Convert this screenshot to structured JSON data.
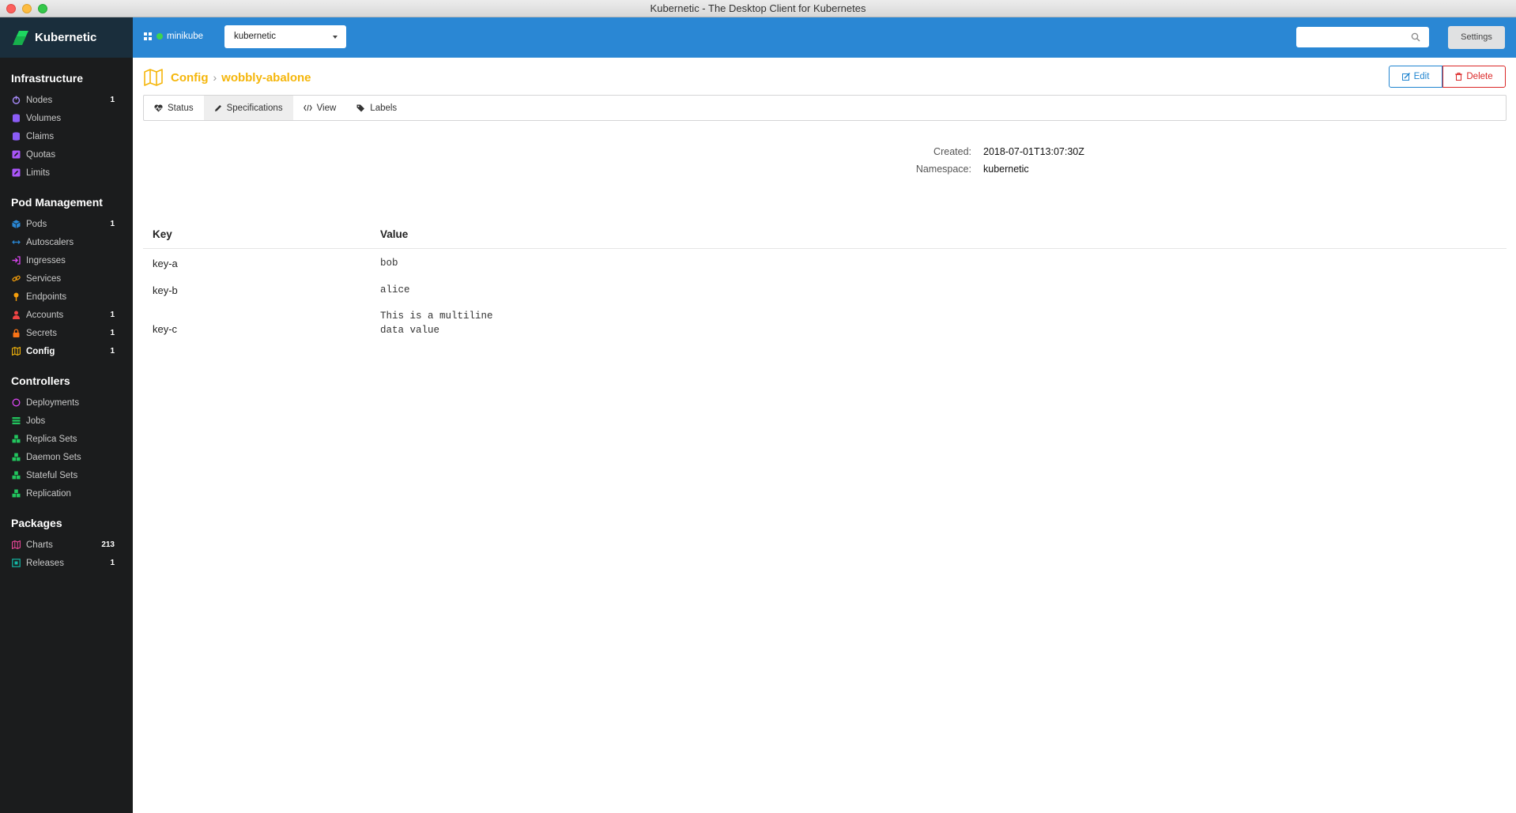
{
  "window": {
    "title": "Kubernetic - The Desktop Client for Kubernetes"
  },
  "brand": {
    "name": "Kubernetic"
  },
  "sidebar": {
    "sections": [
      {
        "title": "Infrastructure",
        "items": [
          {
            "label": "Nodes",
            "count": "1",
            "icon": "power-icon",
            "color": "#a78bfa"
          },
          {
            "label": "Volumes",
            "count": "",
            "icon": "database-icon",
            "color": "#8b5cf6"
          },
          {
            "label": "Claims",
            "count": "",
            "icon": "database-icon",
            "color": "#8b5cf6"
          },
          {
            "label": "Quotas",
            "count": "",
            "icon": "edit-square-icon",
            "color": "#a855f7"
          },
          {
            "label": "Limits",
            "count": "",
            "icon": "edit-square-icon",
            "color": "#a855f7"
          }
        ]
      },
      {
        "title": "Pod Management",
        "items": [
          {
            "label": "Pods",
            "count": "1",
            "icon": "cube-icon",
            "color": "#2a87d4"
          },
          {
            "label": "Autoscalers",
            "count": "",
            "icon": "arrows-h-icon",
            "color": "#2a87d4"
          },
          {
            "label": "Ingresses",
            "count": "",
            "icon": "sign-in-icon",
            "color": "#d946ef"
          },
          {
            "label": "Services",
            "count": "",
            "icon": "link-icon",
            "color": "#f59e0b"
          },
          {
            "label": "Endpoints",
            "count": "",
            "icon": "pin-icon",
            "color": "#f59e0b"
          },
          {
            "label": "Accounts",
            "count": "1",
            "icon": "user-icon",
            "color": "#ef4444"
          },
          {
            "label": "Secrets",
            "count": "1",
            "icon": "lock-icon",
            "color": "#f97316"
          },
          {
            "label": "Config",
            "count": "1",
            "icon": "map-icon",
            "color": "#f5b60b",
            "active": true
          }
        ]
      },
      {
        "title": "Controllers",
        "items": [
          {
            "label": "Deployments",
            "count": "",
            "icon": "circle-icon",
            "color": "#d946ef"
          },
          {
            "label": "Jobs",
            "count": "",
            "icon": "tasks-icon",
            "color": "#22c55e"
          },
          {
            "label": "Replica Sets",
            "count": "",
            "icon": "cubes-icon",
            "color": "#22c55e"
          },
          {
            "label": "Daemon Sets",
            "count": "",
            "icon": "cubes-icon",
            "color": "#22c55e"
          },
          {
            "label": "Stateful Sets",
            "count": "",
            "icon": "cubes-icon",
            "color": "#22c55e"
          },
          {
            "label": "Replication",
            "count": "",
            "icon": "cubes-icon",
            "color": "#22c55e"
          }
        ]
      },
      {
        "title": "Packages",
        "items": [
          {
            "label": "Charts",
            "count": "213",
            "icon": "map-icon",
            "color": "#ec4899"
          },
          {
            "label": "Releases",
            "count": "1",
            "icon": "box-icon",
            "color": "#14b8a6"
          }
        ]
      }
    ]
  },
  "header": {
    "cluster": "minikube",
    "namespace": "kubernetic",
    "search_placeholder": "",
    "settings_label": "Settings"
  },
  "main": {
    "breadcrumb": {
      "parent": "Config",
      "current": "wobbly-abalone"
    },
    "edit_label": "Edit",
    "delete_label": "Delete",
    "tabs": [
      {
        "label": "Status",
        "icon": "heartbeat-icon"
      },
      {
        "label": "Specifications",
        "icon": "pencil-icon",
        "active": true
      },
      {
        "label": "View",
        "icon": "code-icon"
      },
      {
        "label": "Labels",
        "icon": "tags-icon"
      }
    ],
    "meta": {
      "created_label": "Created:",
      "created_value": "2018-07-01T13:07:30Z",
      "namespace_label": "Namespace:",
      "namespace_value": "kubernetic"
    },
    "table": {
      "headers": {
        "key": "Key",
        "value": "Value"
      },
      "rows": [
        {
          "key": "key-a",
          "value": "bob"
        },
        {
          "key": "key-b",
          "value": "alice"
        },
        {
          "key": "key-c",
          "value": "This is a multiline\ndata value"
        }
      ]
    }
  }
}
